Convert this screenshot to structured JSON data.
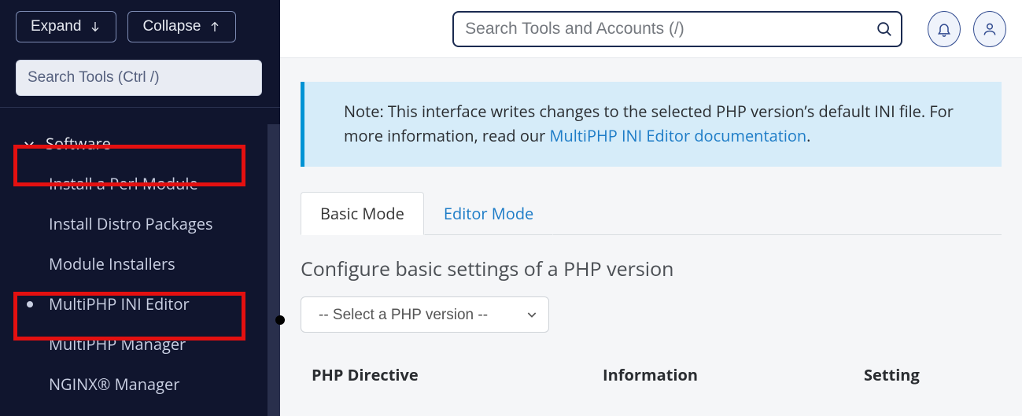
{
  "sidebar": {
    "expand_label": "Expand",
    "collapse_label": "Collapse",
    "search_placeholder": "Search Tools (Ctrl /)",
    "group_label": "Software",
    "items": [
      {
        "label": "Install a Perl Module",
        "active": false
      },
      {
        "label": "Install Distro Packages",
        "active": false
      },
      {
        "label": "Module Installers",
        "active": false
      },
      {
        "label": "MultiPHP INI Editor",
        "active": true
      },
      {
        "label": "MultiPHP Manager",
        "active": false
      },
      {
        "label": "NGINX® Manager",
        "active": false
      }
    ]
  },
  "topbar": {
    "search_placeholder": "Search Tools and Accounts (/)"
  },
  "banner": {
    "prefix": "Note: This interface writes changes to the selected PHP version’s default INI file. For more information, read our ",
    "link_text": "MultiPHP INI Editor documentation",
    "link_color": "#1d7cc7",
    "suffix": "."
  },
  "tabs": [
    {
      "label": "Basic Mode",
      "active": true
    },
    {
      "label": "Editor Mode",
      "active": false
    }
  ],
  "section_heading": "Configure basic settings of a PHP version",
  "select": {
    "placeholder": "-- Select a PHP version --"
  },
  "table": {
    "columns": [
      "PHP Directive",
      "Information",
      "Setting"
    ]
  },
  "colors": {
    "sidebar_bg": "#10152e",
    "accent_blue": "#1d7cc7",
    "highlight_red": "#e41010",
    "banner_bg": "#d6ecf9",
    "banner_border": "#0093d4"
  }
}
